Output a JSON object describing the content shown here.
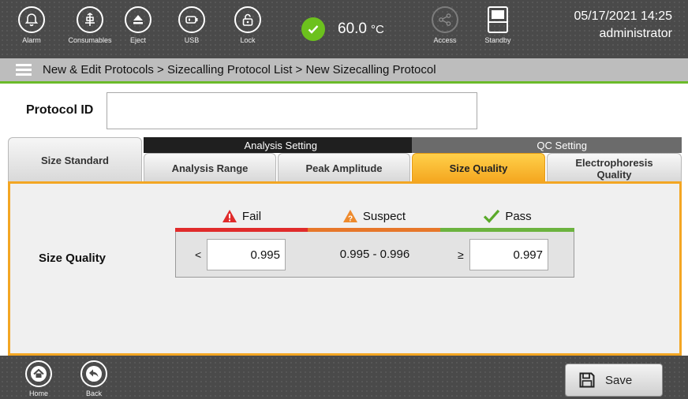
{
  "topbar": {
    "items": [
      {
        "label": "Alarm",
        "icon": "bell-icon"
      },
      {
        "label": "Consumables",
        "icon": "consumables-icon"
      },
      {
        "label": "Eject",
        "icon": "eject-icon"
      },
      {
        "label": "USB",
        "icon": "usb-icon"
      },
      {
        "label": "Lock",
        "icon": "lock-icon"
      },
      {
        "label": "Access",
        "icon": "share-icon"
      },
      {
        "label": "Standby",
        "icon": "standby-icon"
      }
    ],
    "temperature": {
      "value": "60.0",
      "unit": "°C",
      "status_color": "#6cc11d"
    },
    "datetime": "05/17/2021 14:25",
    "user": "administrator"
  },
  "breadcrumb": "New & Edit Protocols > Sizecalling Protocol List > New Sizecalling Protocol",
  "protocol_id": {
    "label": "Protocol ID",
    "value": ""
  },
  "tabs": {
    "size_standard": "Size Standard",
    "analysis_group": "Analysis Setting",
    "qc_group": "QC Setting",
    "analysis_range": "Analysis Range",
    "peak_amplitude": "Peak Amplitude",
    "size_quality": "Size Quality",
    "electrophoresis_quality": "Electrophoresis Quality",
    "active": "Size Quality"
  },
  "quality": {
    "row_label": "Size Quality",
    "fail": {
      "label": "Fail",
      "color": "#e02b2b",
      "symbol": "<",
      "value": "0.995"
    },
    "suspect": {
      "label": "Suspect",
      "color": "#e7772a",
      "range": "0.995 - 0.996"
    },
    "pass": {
      "label": "Pass",
      "color": "#6cb33f",
      "symbol": "≥",
      "value": "0.997"
    }
  },
  "bottombar": {
    "home": "Home",
    "back": "Back",
    "save": "Save"
  },
  "colors": {
    "accent": "#f3a623",
    "breadcrumb_underline": "#6bbb2a"
  }
}
